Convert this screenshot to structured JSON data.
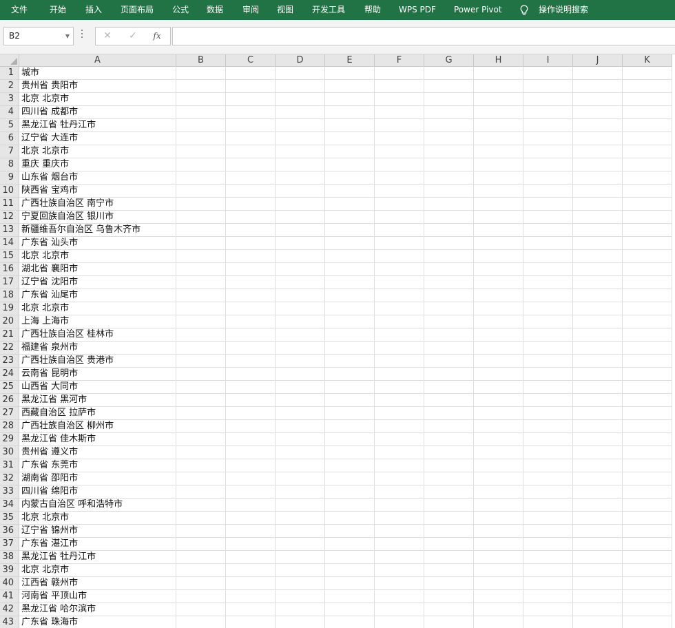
{
  "ribbon": {
    "tabs": [
      "文件",
      "开始",
      "插入",
      "页面布局",
      "公式",
      "数据",
      "审阅",
      "视图",
      "开发工具",
      "帮助",
      "WPS PDF",
      "Power Pivot"
    ],
    "search_label": "操作说明搜索",
    "color": "#217346"
  },
  "formula_bar": {
    "name_box": "B2",
    "cancel_symbol": "✕",
    "enter_symbol": "✓",
    "fx_label": "fx",
    "formula_value": ""
  },
  "sheet": {
    "columns": [
      "A",
      "B",
      "C",
      "D",
      "E",
      "F",
      "G",
      "H",
      "I",
      "J",
      "K"
    ],
    "selected_cell": "B2",
    "rows": [
      {
        "num": "1",
        "a": "城市"
      },
      {
        "num": "2",
        "a": "贵州省 贵阳市"
      },
      {
        "num": "3",
        "a": "北京 北京市"
      },
      {
        "num": "4",
        "a": "四川省 成都市"
      },
      {
        "num": "5",
        "a": "黑龙江省 牡丹江市"
      },
      {
        "num": "6",
        "a": "辽宁省 大连市"
      },
      {
        "num": "7",
        "a": "北京 北京市"
      },
      {
        "num": "8",
        "a": "重庆 重庆市"
      },
      {
        "num": "9",
        "a": "山东省 烟台市"
      },
      {
        "num": "10",
        "a": "陕西省 宝鸡市"
      },
      {
        "num": "11",
        "a": "广西壮族自治区 南宁市"
      },
      {
        "num": "12",
        "a": "宁夏回族自治区 银川市"
      },
      {
        "num": "13",
        "a": "新疆维吾尔自治区 乌鲁木齐市"
      },
      {
        "num": "14",
        "a": "广东省 汕头市"
      },
      {
        "num": "15",
        "a": "北京 北京市"
      },
      {
        "num": "16",
        "a": "湖北省 襄阳市"
      },
      {
        "num": "17",
        "a": "辽宁省 沈阳市"
      },
      {
        "num": "18",
        "a": "广东省 汕尾市"
      },
      {
        "num": "19",
        "a": "北京 北京市"
      },
      {
        "num": "20",
        "a": "上海 上海市"
      },
      {
        "num": "21",
        "a": "广西壮族自治区 桂林市"
      },
      {
        "num": "22",
        "a": "福建省 泉州市"
      },
      {
        "num": "23",
        "a": "广西壮族自治区 贵港市"
      },
      {
        "num": "24",
        "a": "云南省 昆明市"
      },
      {
        "num": "25",
        "a": "山西省 大同市"
      },
      {
        "num": "26",
        "a": "黑龙江省 黑河市"
      },
      {
        "num": "27",
        "a": "西藏自治区 拉萨市"
      },
      {
        "num": "28",
        "a": "广西壮族自治区 柳州市"
      },
      {
        "num": "29",
        "a": "黑龙江省 佳木斯市"
      },
      {
        "num": "30",
        "a": "贵州省 遵义市"
      },
      {
        "num": "31",
        "a": "广东省 东莞市"
      },
      {
        "num": "32",
        "a": "湖南省 邵阳市"
      },
      {
        "num": "33",
        "a": "四川省 绵阳市"
      },
      {
        "num": "34",
        "a": "内蒙古自治区 呼和浩特市"
      },
      {
        "num": "35",
        "a": "北京 北京市"
      },
      {
        "num": "36",
        "a": "辽宁省 锦州市"
      },
      {
        "num": "37",
        "a": "广东省 湛江市"
      },
      {
        "num": "38",
        "a": "黑龙江省 牡丹江市"
      },
      {
        "num": "39",
        "a": "北京 北京市"
      },
      {
        "num": "40",
        "a": "江西省 赣州市"
      },
      {
        "num": "41",
        "a": "河南省 平顶山市"
      },
      {
        "num": "42",
        "a": "黑龙江省 哈尔滨市"
      },
      {
        "num": "43",
        "a": "广东省 珠海市"
      }
    ]
  }
}
